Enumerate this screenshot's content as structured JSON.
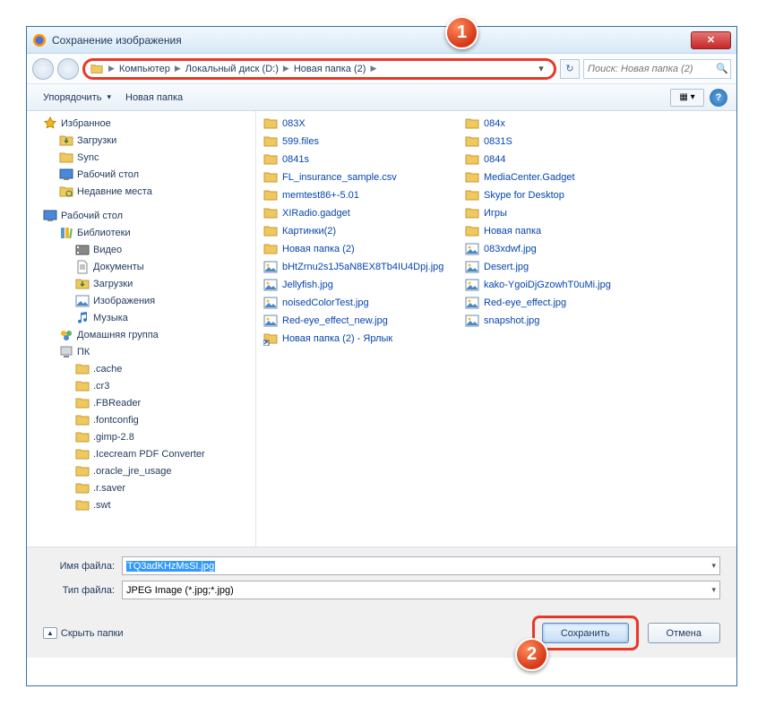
{
  "title": "Сохранение изображения",
  "breadcrumb": [
    "Компьютер",
    "Локальный диск (D:)",
    "Новая папка (2)"
  ],
  "search_placeholder": "Поиск: Новая папка (2)",
  "toolbar": {
    "organize": "Упорядочить",
    "new_folder": "Новая папка"
  },
  "sidebar": {
    "favorites": {
      "label": "Избранное",
      "items": [
        "Загрузки",
        "Sync",
        "Рабочий стол",
        "Недавние места"
      ]
    },
    "desktop": {
      "label": "Рабочий стол"
    },
    "libraries": {
      "label": "Библиотеки",
      "items": [
        "Видео",
        "Документы",
        "Загрузки",
        "Изображения",
        "Музыка"
      ]
    },
    "homegroup": "Домашняя группа",
    "pc": {
      "label": "ПК",
      "items": [
        ".cache",
        ".cr3",
        ".FBReader",
        ".fontconfig",
        ".gimp-2.8",
        ".Icecream PDF Converter",
        ".oracle_jre_usage",
        ".r.saver",
        ".swt"
      ]
    }
  },
  "files": {
    "col1": [
      {
        "name": "083X",
        "type": "folder"
      },
      {
        "name": "599.files",
        "type": "folder"
      },
      {
        "name": "0841s",
        "type": "folder"
      },
      {
        "name": "FL_insurance_sample.csv",
        "type": "folder"
      },
      {
        "name": "memtest86+-5.01",
        "type": "folder"
      },
      {
        "name": "XIRadio.gadget",
        "type": "folder"
      },
      {
        "name": "Картинки(2)",
        "type": "folder"
      },
      {
        "name": "Новая папка (2)",
        "type": "folder"
      },
      {
        "name": "bHtZrnu2s1J5aN8EX8Tb4IU4Dpj.jpg",
        "type": "image"
      },
      {
        "name": "Jellyfish.jpg",
        "type": "image"
      },
      {
        "name": "noisedColorTest.jpg",
        "type": "image"
      },
      {
        "name": "Red-eye_effect_new.jpg",
        "type": "image"
      },
      {
        "name": "Новая папка (2) - Ярлык",
        "type": "shortcut"
      }
    ],
    "col2": [
      {
        "name": "084x",
        "type": "folder"
      },
      {
        "name": "0831S",
        "type": "folder"
      },
      {
        "name": "0844",
        "type": "folder"
      },
      {
        "name": "MediaCenter.Gadget",
        "type": "folder"
      },
      {
        "name": "Skype for Desktop",
        "type": "folder"
      },
      {
        "name": "Игры",
        "type": "folder"
      },
      {
        "name": "Новая папка",
        "type": "folder"
      },
      {
        "name": "083xdwf.jpg",
        "type": "image"
      },
      {
        "name": "Desert.jpg",
        "type": "image"
      },
      {
        "name": "kako-YgoiDjGzowhT0uMi.jpg",
        "type": "image"
      },
      {
        "name": "Red-eye_effect.jpg",
        "type": "image"
      },
      {
        "name": "snapshot.jpg",
        "type": "image"
      }
    ]
  },
  "filename_label": "Имя файла:",
  "filename_value": "TQ3adKHzMsSI.jpg",
  "filetype_label": "Тип файла:",
  "filetype_value": "JPEG Image (*.jpg;*.jpg)",
  "hide_folders": "Скрыть папки",
  "save": "Сохранить",
  "cancel": "Отмена",
  "badge1": "1",
  "badge2": "2"
}
